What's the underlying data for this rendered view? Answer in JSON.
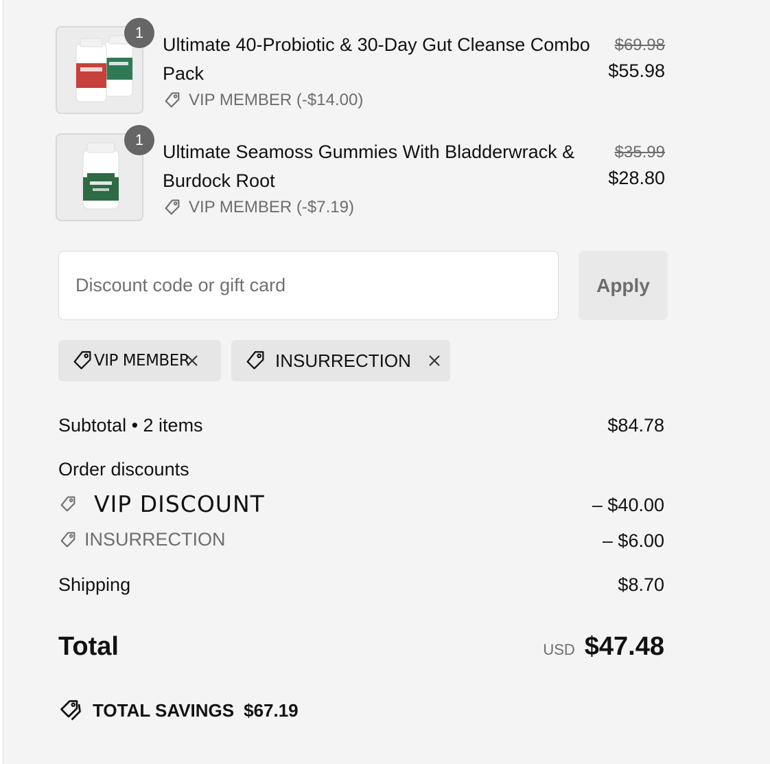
{
  "items": [
    {
      "quantity": "1",
      "title": "Ultimate 40-Probiotic & 30-Day Gut Cleanse Combo Pack",
      "discount": "VIP MEMBER (-$14.00)",
      "price_original": "$69.98",
      "price_final": "$55.98",
      "image_icon": "probiotic-cleanse-bottles-image"
    },
    {
      "quantity": "1",
      "title": "Ultimate Seamoss Gummies With Bladderwrack & Burdock Root",
      "discount": "VIP MEMBER (-$7.19)",
      "price_original": "$35.99",
      "price_final": "$28.80",
      "image_icon": "seamoss-bottle-image"
    }
  ],
  "discount": {
    "placeholder": "Discount code or gift card",
    "apply_label": "Apply"
  },
  "applied_codes": [
    {
      "label": "VIP MEMBER"
    },
    {
      "label": "INSURRECTION"
    }
  ],
  "subtotal": {
    "label": "Subtotal • 2 items",
    "value": "$84.78"
  },
  "order_discounts": {
    "label": "Order discounts",
    "lines": [
      {
        "label": "VIP DISCOUNT",
        "value": "– $40.00"
      },
      {
        "label": "INSURRECTION",
        "value": "– $6.00"
      }
    ]
  },
  "shipping": {
    "label": "Shipping",
    "value": "$8.70"
  },
  "total": {
    "label": "Total",
    "currency": "USD",
    "value": "$47.48"
  },
  "savings": {
    "label": "TOTAL SAVINGS",
    "value": "$67.19"
  },
  "colors": {
    "panel_bg": "#f4f4f4",
    "text": "#111111",
    "muted": "#6d6d6d",
    "badge": "#666666",
    "chip_bg": "#e6e6e6"
  }
}
